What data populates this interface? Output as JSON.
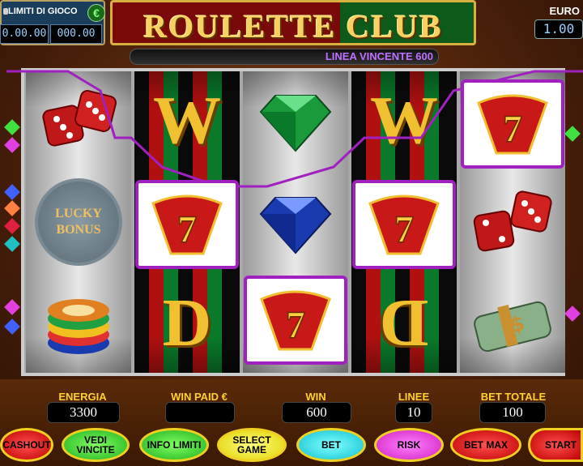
{
  "limits": {
    "title": "LIMITI DI GIOCO",
    "currency_symbol": "€",
    "left_value": "0.00.00",
    "right_value": "000.00"
  },
  "title": "ROULETTE CLUB",
  "balance": {
    "label": "EURO",
    "value": "1.00"
  },
  "win_line": "LINEA VINCENTE 600",
  "reels": [
    {
      "style": "grey",
      "symbols": [
        "dice",
        "lucky-bonus",
        "chips"
      ]
    },
    {
      "style": "stripe",
      "symbols": [
        "wild",
        "seven",
        "wild"
      ]
    },
    {
      "style": "grey",
      "symbols": [
        "green-diamond",
        "blue-diamond",
        "seven"
      ]
    },
    {
      "style": "stripe",
      "symbols": [
        "wild",
        "seven",
        "wild"
      ]
    },
    {
      "style": "grey",
      "symbols": [
        "seven",
        "dice",
        "money"
      ]
    }
  ],
  "symbol_text": {
    "lucky_bonus_line1": "LUCKY",
    "lucky_bonus_line2": "BONUS",
    "seven": "7",
    "wild_top": "W",
    "wild_bottom": "D"
  },
  "stats": {
    "energia": {
      "label": "ENERGIA",
      "value": "3300"
    },
    "win_paid": {
      "label": "WIN PAID €",
      "value": ""
    },
    "win": {
      "label": "WIN",
      "value": "600"
    },
    "linee": {
      "label": "LINEE",
      "value": "10"
    },
    "bet_totale": {
      "label": "BET TOTALE",
      "value": "100"
    }
  },
  "buttons": {
    "cashout": "CASHOUT",
    "vedi_vincite": "VEDI VINCITE",
    "info_limiti": "INFO LIMITI",
    "select_game": "SELECT GAME",
    "bet": "BET",
    "risk": "RISK",
    "bet_max": "BET MAX",
    "start": "START"
  },
  "colors": {
    "win_highlight": "#a020c0",
    "label_gold": "#ffd030"
  }
}
